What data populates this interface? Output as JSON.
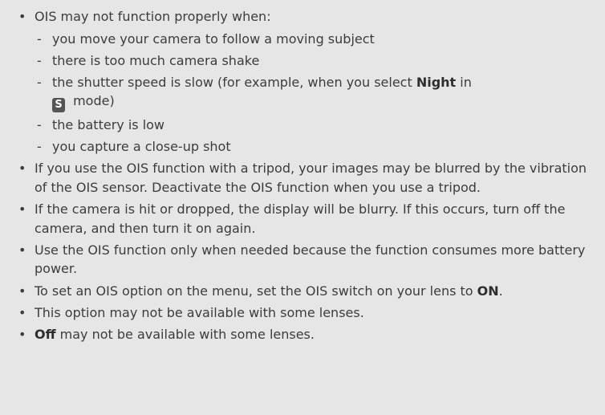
{
  "notes": [
    {
      "text": "OIS may not function properly when:",
      "subitems": [
        {
          "text": "you move your camera to follow a moving subject"
        },
        {
          "text": "there is too much camera shake"
        },
        {
          "pre": "the shutter speed is slow (for example, when you select ",
          "bold": "Night",
          "post": " in",
          "badge": "S",
          "post2": " mode)"
        },
        {
          "text": "the battery is low"
        },
        {
          "text": "you capture a close-up shot"
        }
      ]
    },
    {
      "text": "If you use the OIS function with a tripod, your images may be blurred by the vibration of the OIS sensor. Deactivate the OIS function when you use a tripod."
    },
    {
      "text": "If the camera is hit or dropped, the display will be blurry. If this occurs, turn off the camera, and then turn it on again."
    },
    {
      "text": "Use the OIS function only when needed because the function consumes more battery power."
    },
    {
      "pre": "To set an OIS option on the menu, set the OIS switch on your lens to ",
      "bold": "ON",
      "post": "."
    },
    {
      "text": "This option may not be available with some lenses."
    },
    {
      "bold": "Off",
      "post": " may not be available with some lenses."
    }
  ]
}
